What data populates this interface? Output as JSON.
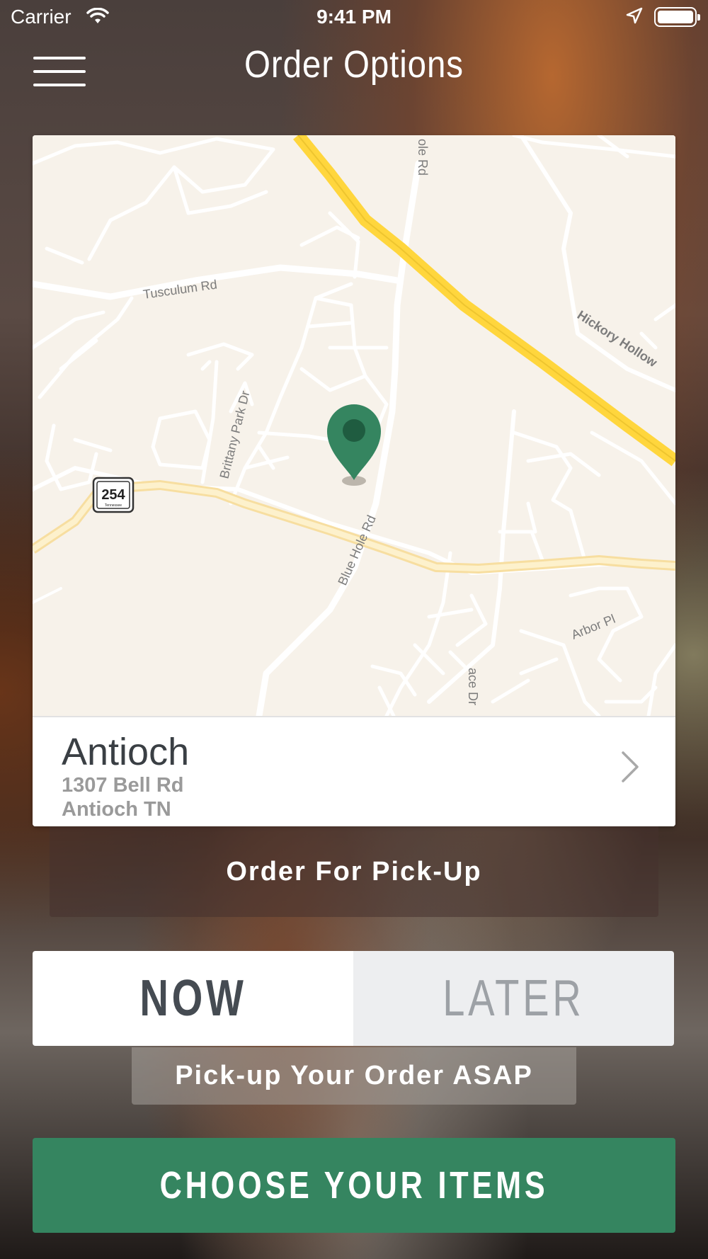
{
  "status_bar": {
    "carrier": "Carrier",
    "time": "9:41 PM",
    "icons": [
      "wifi-icon",
      "location-arrow-icon",
      "battery-icon"
    ]
  },
  "header": {
    "title": "Order Options",
    "menu_icon": "hamburger-menu-icon"
  },
  "map": {
    "road_labels": [
      "Tusculum Rd",
      "Brittany Park Dr",
      "Blue Hole Rd",
      "ole Rd",
      "Hickory Hollow",
      "Arbor Pl",
      "ace Dr"
    ],
    "route_shield": "254",
    "route_shield_caption": "Tennessee",
    "pin_color": "#358560"
  },
  "store": {
    "name": "Antioch",
    "address": "1307 Bell Rd",
    "city": "Antioch TN"
  },
  "order_mode": {
    "label": "Order For Pick-Up"
  },
  "timing": {
    "options": [
      "NOW",
      "LATER"
    ],
    "selected": "NOW",
    "note": "Pick-up Your Order ASAP"
  },
  "cta": {
    "label": "CHOOSE YOUR ITEMS",
    "color": "#358560"
  }
}
